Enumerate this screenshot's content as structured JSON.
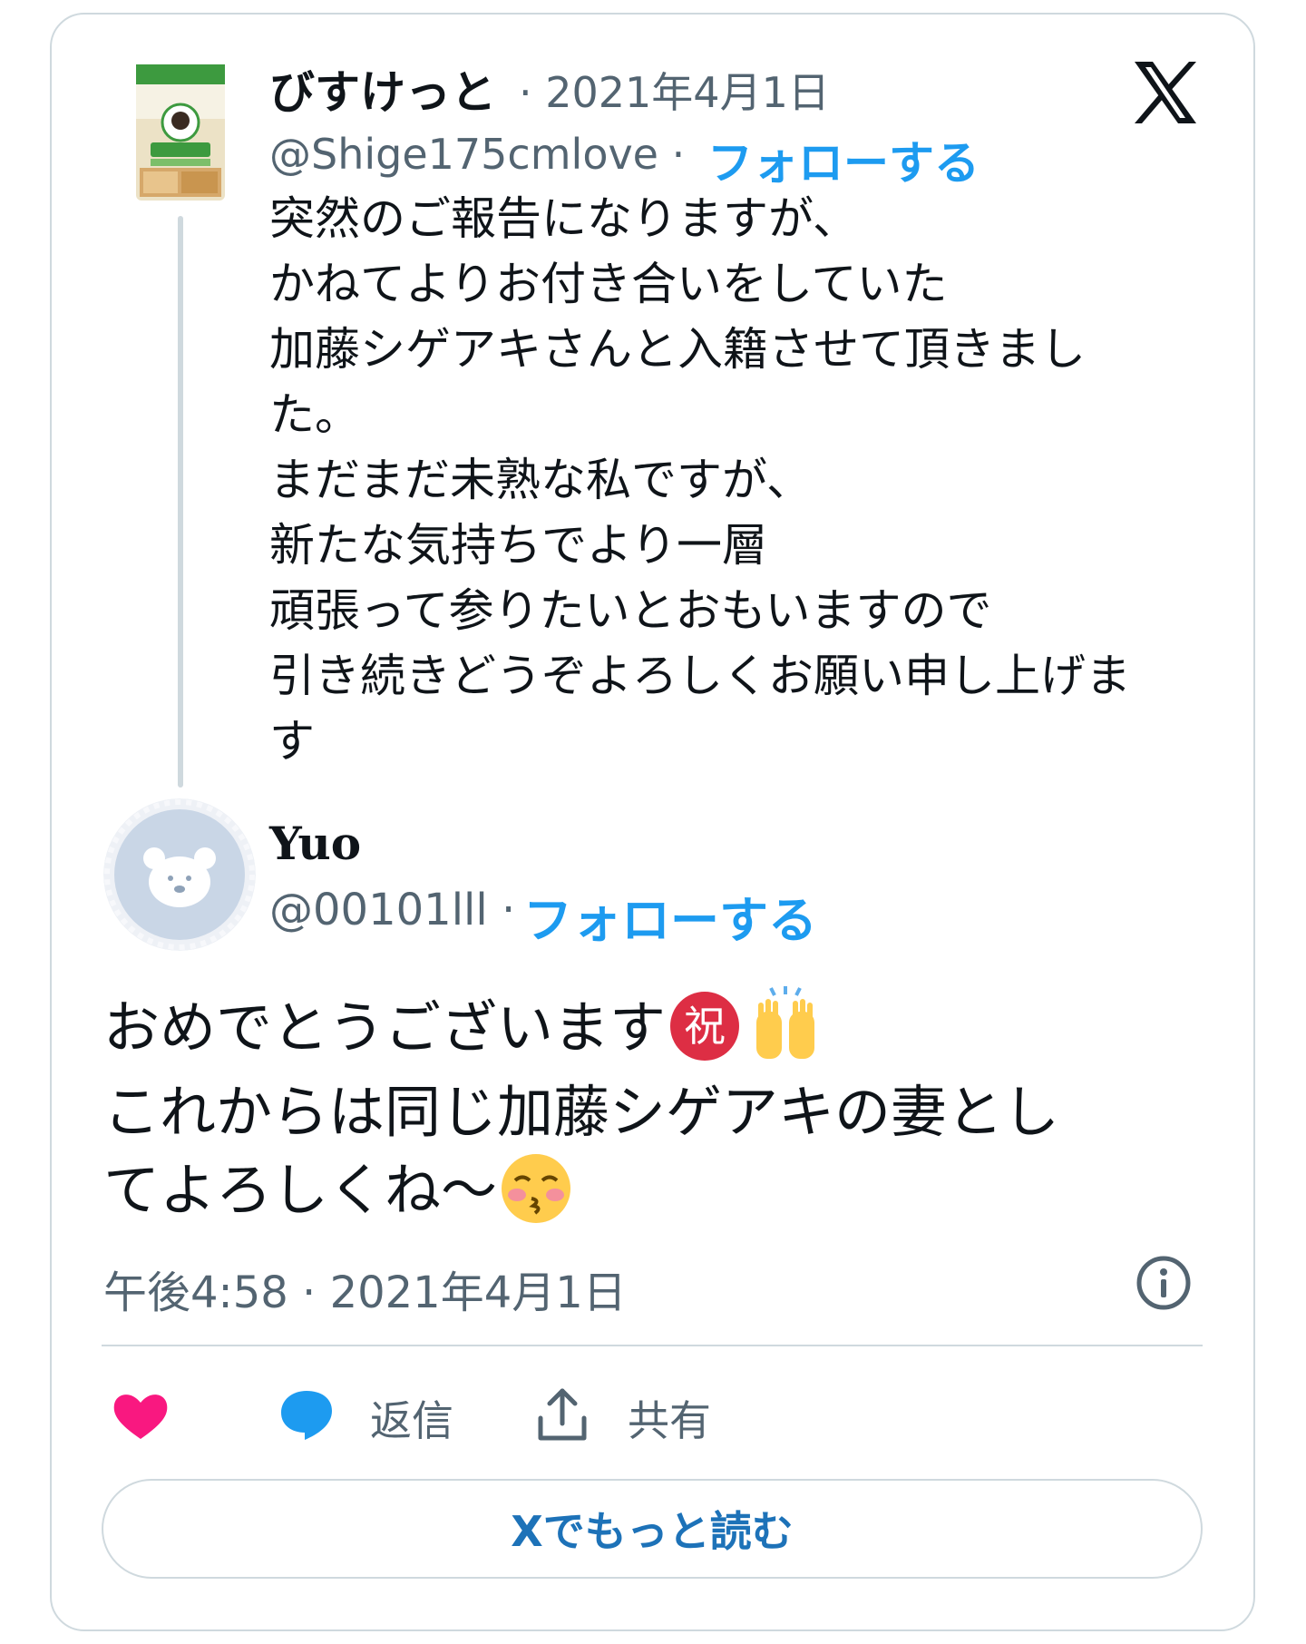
{
  "colors": {
    "accent": "#1d9bf0",
    "muted": "#536471",
    "border": "#cfd9de",
    "heart": "#f91880"
  },
  "quoted_tweet": {
    "display_name": "びすけっと",
    "date": "· 2021年4月1日",
    "handle": "@Shige175cmlove",
    "separator": "·",
    "follow_label": "フォローする",
    "lines": [
      "突然のご報告になりますが、",
      "かねてよりお付き合いをしていた",
      "加藤シゲアキさんと入籍させて頂きまし",
      "た。",
      "まだまだ未熟な私ですが、",
      "新たな気持ちでより一層",
      "頑張って参りたいとおもいますので",
      "引き続きどうぞよろしくお願い申し上げま",
      "す"
    ]
  },
  "reply_tweet": {
    "display_name": "Yuo",
    "handle": "@00101lll",
    "separator": "·",
    "follow_label": "フォローする",
    "line1": "おめでとうございます",
    "line2": "これからは同じ加藤シゲアキの妻とし",
    "line3": "てよろしくね〜",
    "emoji_celebrate": "祝",
    "icons": [
      "celebrate-emoji-icon",
      "raised-hands-emoji-icon",
      "kissing-face-emoji-icon"
    ]
  },
  "meta": {
    "timestamp": "午後4:58 · 2021年4月1日"
  },
  "actions": {
    "reply_label": "返信",
    "share_label": "共有"
  },
  "read_more_label": "Xでもっと読む"
}
